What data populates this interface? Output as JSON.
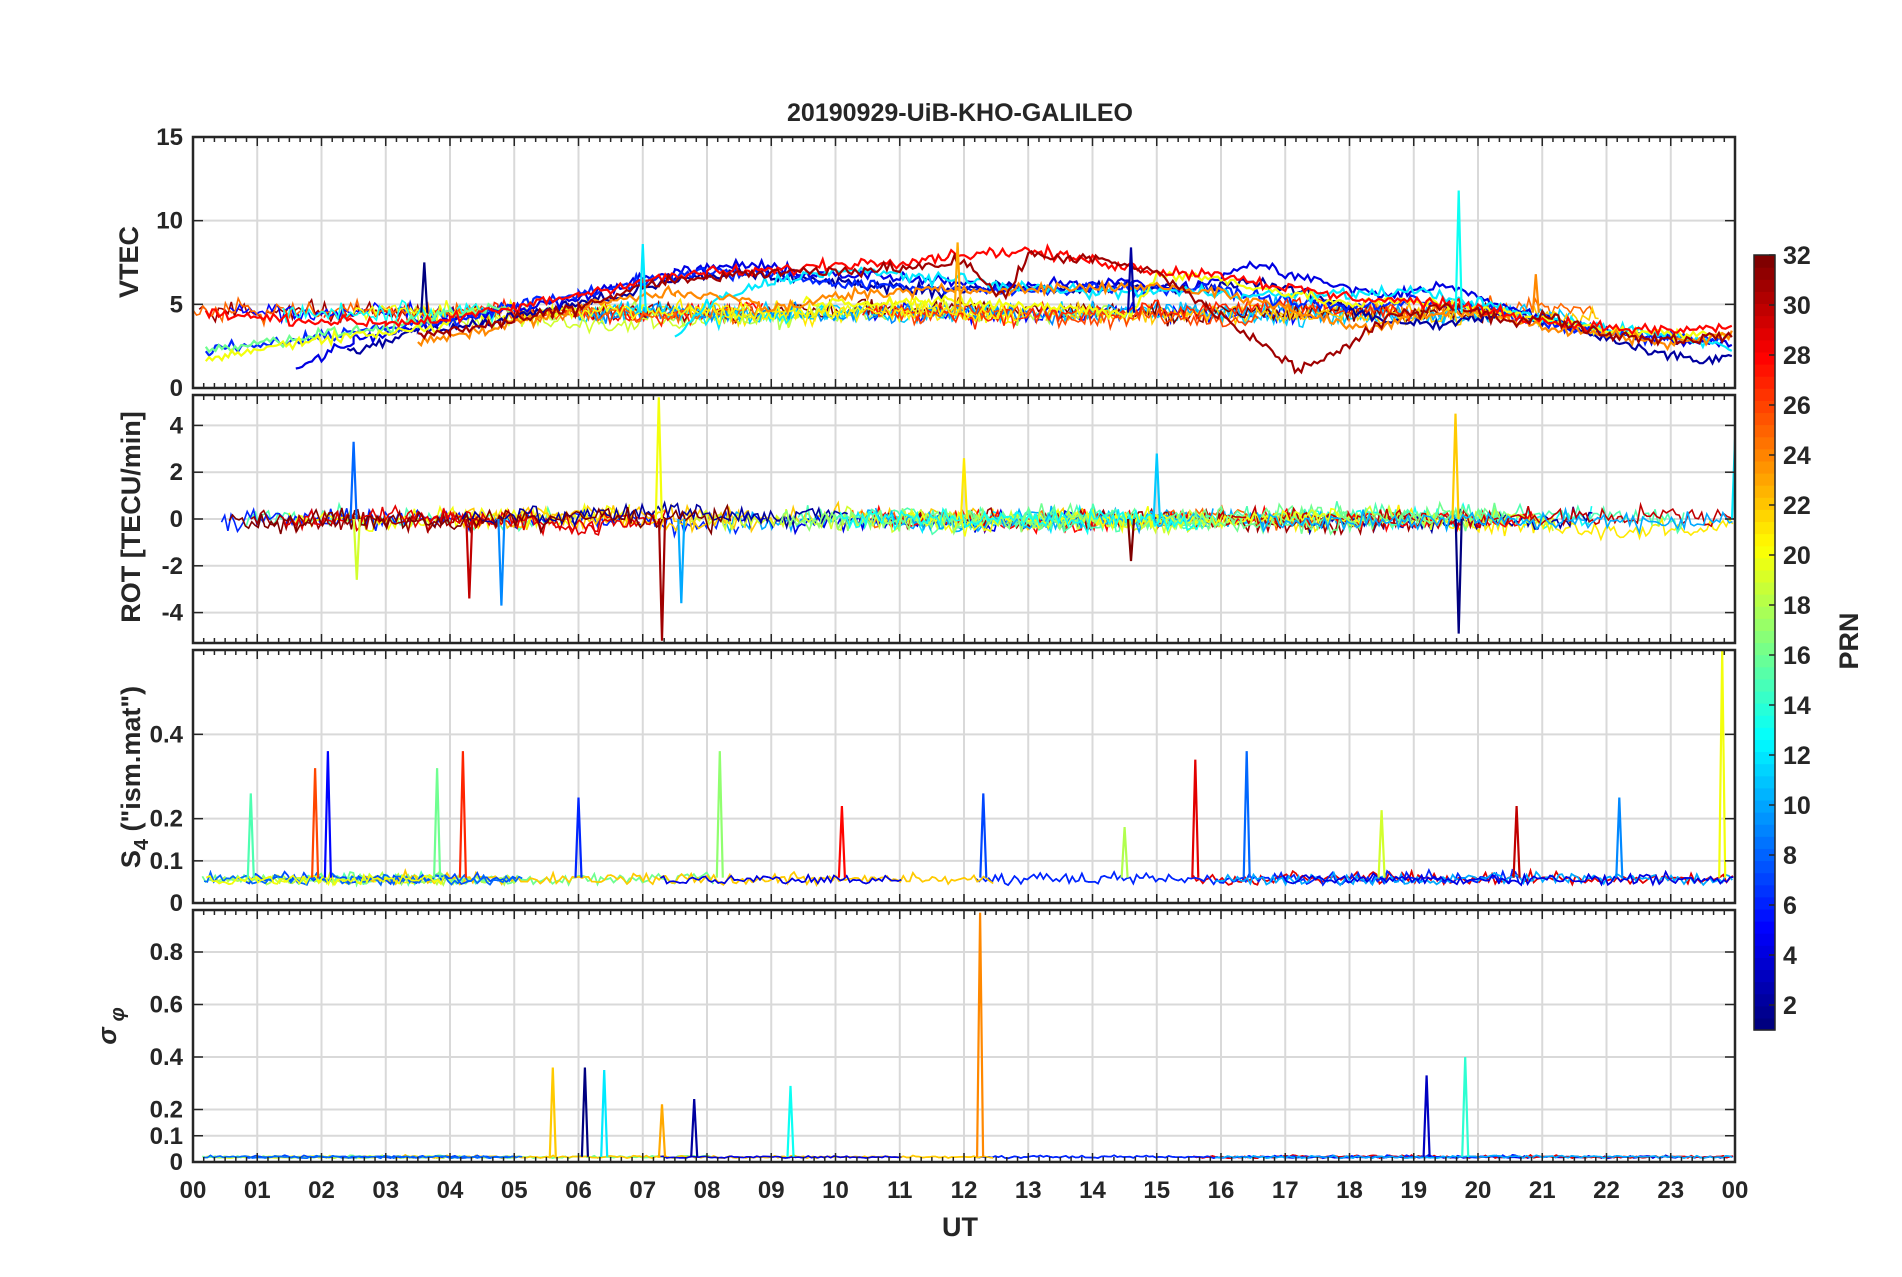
{
  "title": "20190929-UiB-KHO-GALILEO",
  "xlabel": "UT",
  "x_ticks": [
    "00",
    "01",
    "02",
    "03",
    "04",
    "05",
    "06",
    "07",
    "08",
    "09",
    "10",
    "11",
    "12",
    "13",
    "14",
    "15",
    "16",
    "17",
    "18",
    "19",
    "20",
    "21",
    "22",
    "23",
    "00"
  ],
  "chart_data": [
    {
      "type": "line",
      "ylabel": "VTEC",
      "ylim": [
        0,
        15
      ],
      "yticks": [
        0,
        5,
        10,
        15
      ],
      "grid": true,
      "baseline": 4.5,
      "noise": 0.4,
      "dense_series": 24,
      "events": [
        {
          "x": 3.6,
          "y": 7.5
        },
        {
          "x": 7.0,
          "y": 8.6
        },
        {
          "x": 11.9,
          "y": 8.7
        },
        {
          "x": 14.6,
          "y": 8.4
        },
        {
          "x": 19.7,
          "y": 11.8
        },
        {
          "x": 20.9,
          "y": 6.8
        }
      ],
      "series": [
        {
          "prn": 2,
          "x": [
            2.4,
            3.5,
            4.5,
            5.5,
            6.5,
            7.5,
            8.5,
            9.5,
            10.5,
            11.5,
            12.5,
            13.5,
            14.5,
            15.5,
            16.5,
            17.5,
            18.5,
            19.5,
            20.5,
            21.5,
            22.5,
            23.5,
            24.0
          ],
          "y": [
            2.0,
            3.5,
            3.8,
            4.7,
            5.4,
            6.4,
            6.9,
            6.5,
            6.2,
            5.8,
            6.1,
            5.8,
            6.1,
            5.9,
            6.4,
            5.4,
            4.1,
            3.8,
            4.5,
            3.6,
            2.3,
            1.6,
            2.2
          ]
        },
        {
          "prn": 4,
          "x": [
            1.6,
            2.5,
            3.5,
            4.5,
            5.5,
            6.5,
            7.5,
            8.5,
            9.5,
            10.5,
            11.5,
            12.5,
            13.5,
            14.5,
            15.5,
            16.5,
            17.5,
            18.5,
            19.5,
            20.5,
            21.5,
            22.5,
            23.5,
            24.0
          ],
          "y": [
            1.1,
            2.9,
            3.7,
            4.5,
            5.0,
            6.0,
            6.9,
            7.4,
            6.9,
            6.7,
            6.4,
            6.0,
            6.3,
            6.3,
            5.9,
            7.4,
            6.4,
            5.5,
            6.1,
            4.8,
            3.6,
            3.2,
            2.6,
            2.7
          ]
        },
        {
          "prn": 6,
          "x": [
            0.2,
            1.0,
            2.0,
            3.0,
            4.0,
            5.0,
            6.0,
            7.0,
            8.0,
            9.0,
            10.0,
            11.0,
            12.0,
            13.0,
            14.0,
            15.0,
            16.0,
            17.0,
            18.0,
            19.0,
            20.0,
            21.0,
            22.0,
            23.0,
            24.0
          ],
          "y": [
            2.3,
            2.6,
            3.1,
            3.6,
            4.0,
            4.9,
            5.6,
            6.4,
            6.9,
            6.8,
            6.3,
            6.1,
            5.8,
            5.8,
            6.0,
            5.9,
            5.9,
            5.2,
            4.8,
            5.2,
            4.9,
            3.8,
            3.3,
            3.0,
            2.9
          ]
        },
        {
          "prn": 12,
          "x": [
            7.5,
            8.0,
            9.0,
            10.0,
            11.0,
            12.0,
            13.0,
            14.0,
            15.0,
            16.0,
            17.0,
            18.0,
            19.0,
            20.0,
            21.0,
            22.0,
            23.0,
            24.0
          ],
          "y": [
            3.0,
            5.0,
            6.4,
            7.0,
            6.8,
            6.4,
            6.0,
            5.7,
            5.8,
            5.7,
            5.5,
            5.6,
            5.8,
            5.1,
            4.1,
            3.6,
            3.2,
            2.3
          ]
        },
        {
          "prn": 16,
          "x": [
            0.2,
            1.0,
            2.0,
            3.0,
            4.0,
            5.0
          ],
          "y": [
            2.3,
            2.7,
            3.2,
            3.6,
            4.4,
            4.8
          ]
        },
        {
          "prn": 20,
          "x": [
            0.2,
            1.0,
            2.0,
            3.0,
            4.0,
            9.5,
            10.0,
            11.0,
            12.0,
            13.0,
            14.0,
            14.6,
            15.0,
            16.0,
            17.0,
            18.0,
            19.0,
            20.0,
            21.0,
            22.0,
            23.0,
            24.0
          ],
          "y": [
            1.6,
            2.3,
            3.0,
            3.3,
            3.8,
            5.2,
            5.1,
            5.2,
            5.1,
            4.9,
            4.7,
            4.4,
            6.8,
            6.5,
            5.7,
            5.0,
            5.2,
            4.8,
            4.0,
            3.5,
            3.2,
            3.2
          ]
        },
        {
          "prn": 24,
          "x": [
            3.5,
            4.5,
            5.5,
            6.5,
            7.5,
            8.5,
            9.0,
            9.5,
            10.0,
            11.0,
            12.0,
            13.0,
            14.0,
            15.0,
            16.0,
            17.0,
            18.0,
            18.5,
            19.0,
            20.0,
            21.0,
            22.0,
            23.0,
            24.0
          ],
          "y": [
            2.9,
            3.4,
            4.3,
            5.2,
            5.8,
            5.3,
            4.7,
            4.9,
            5.6,
            5.7,
            5.9,
            5.9,
            6.0,
            6.1,
            5.7,
            4.8,
            3.7,
            3.6,
            4.4,
            4.6,
            3.6,
            3.2,
            2.7,
            3.2
          ]
        },
        {
          "prn": 28,
          "x": [
            0.2,
            1.0,
            2.0,
            3.0,
            4.0,
            5.0,
            6.0,
            7.0,
            8.0,
            9.0,
            10.0,
            11.0,
            12.0,
            13.0,
            14.0,
            15.0,
            16.0,
            17.0,
            18.0,
            19.0,
            20.0,
            21.0,
            22.0,
            23.0,
            24.0
          ],
          "y": [
            4.5,
            4.2,
            4.0,
            3.9,
            4.1,
            4.8,
            5.6,
            6.4,
            6.9,
            7.0,
            7.4,
            7.6,
            8.0,
            8.2,
            7.6,
            7.0,
            6.8,
            6.0,
            5.4,
            5.2,
            4.8,
            4.0,
            3.6,
            3.4,
            3.7
          ]
        },
        {
          "prn": 31,
          "x": [
            3.5,
            4.0,
            5.0,
            6.0,
            7.0,
            8.0,
            9.0,
            10.0,
            11.0,
            12.0,
            12.6,
            13.0,
            14.0,
            15.0,
            17.2,
            18.0,
            18.6,
            19.5,
            20.0,
            20.5,
            21.0,
            22.0,
            23.0,
            24.0
          ],
          "y": [
            3.1,
            3.4,
            4.0,
            4.8,
            6.1,
            6.6,
            6.9,
            6.9,
            7.2,
            7.6,
            5.3,
            7.9,
            7.7,
            6.9,
            1.1,
            2.5,
            4.2,
            5.0,
            4.6,
            3.8,
            4.4,
            3.2,
            2.9,
            3.1
          ]
        }
      ]
    },
    {
      "type": "line",
      "ylabel": "ROT [TECU/min]",
      "ylim": [
        -5.3,
        5.3
      ],
      "yticks": [
        -4,
        -2,
        0,
        2,
        4
      ],
      "grid": true,
      "baseline": 0,
      "noise": 0.3,
      "dense_series": 32,
      "events": [
        {
          "x": 2.5,
          "y": 3.3
        },
        {
          "x": 2.55,
          "y": -2.6
        },
        {
          "x": 4.3,
          "y": -3.4
        },
        {
          "x": 4.8,
          "y": -3.7
        },
        {
          "x": 7.25,
          "y": 5.2
        },
        {
          "x": 7.3,
          "y": -5.2
        },
        {
          "x": 7.6,
          "y": -3.6
        },
        {
          "x": 12.0,
          "y": 2.6
        },
        {
          "x": 14.6,
          "y": -1.8
        },
        {
          "x": 15.0,
          "y": 2.8
        },
        {
          "x": 19.65,
          "y": 4.5
        },
        {
          "x": 19.7,
          "y": -4.9
        },
        {
          "x": 24.0,
          "y": 3.4
        }
      ],
      "series": [
        {
          "prn": 3,
          "x": [
            0.2,
            24.0
          ],
          "y": [
            0,
            0
          ]
        },
        {
          "prn": 29,
          "x": [
            0.2,
            24.0
          ],
          "y": [
            0,
            0
          ]
        }
      ]
    },
    {
      "type": "line",
      "ylabel": "S4 (\"ism.mat\")",
      "ylabel_main": "S",
      "ylabel_sub": "4",
      "ylabel_rest": " (\"ism.mat\")",
      "ylim": [
        0,
        0.6
      ],
      "yticks": [
        0,
        0.1,
        0.2,
        0.4
      ],
      "grid": true,
      "baseline": 0.06,
      "noise": 0.015,
      "dense_series": 26,
      "events": [
        {
          "x": 0.9,
          "y": 0.26
        },
        {
          "x": 1.9,
          "y": 0.32
        },
        {
          "x": 2.1,
          "y": 0.36
        },
        {
          "x": 3.8,
          "y": 0.32
        },
        {
          "x": 4.2,
          "y": 0.36
        },
        {
          "x": 6.0,
          "y": 0.25
        },
        {
          "x": 8.2,
          "y": 0.36
        },
        {
          "x": 10.1,
          "y": 0.23
        },
        {
          "x": 12.3,
          "y": 0.26
        },
        {
          "x": 14.5,
          "y": 0.18
        },
        {
          "x": 15.6,
          "y": 0.34
        },
        {
          "x": 16.4,
          "y": 0.36
        },
        {
          "x": 18.5,
          "y": 0.22
        },
        {
          "x": 20.6,
          "y": 0.23
        },
        {
          "x": 22.2,
          "y": 0.25
        },
        {
          "x": 23.8,
          "y": 0.6
        }
      ],
      "series": [
        {
          "prn": 5,
          "x": [
            0.2,
            24.0
          ],
          "y": [
            0.05,
            0.05
          ]
        }
      ]
    },
    {
      "type": "line",
      "ylabel": "σφ",
      "ylabel_main": "σ",
      "ylabel_sub": "φ",
      "ylim": [
        0,
        0.96
      ],
      "yticks": [
        0,
        0.1,
        0.2,
        0.4,
        0.6,
        0.8
      ],
      "grid": true,
      "baseline": 0.02,
      "noise": 0.006,
      "dense_series": 22,
      "events": [
        {
          "x": 5.6,
          "y": 0.36
        },
        {
          "x": 6.1,
          "y": 0.36
        },
        {
          "x": 6.4,
          "y": 0.35
        },
        {
          "x": 7.3,
          "y": 0.22
        },
        {
          "x": 7.8,
          "y": 0.24
        },
        {
          "x": 9.3,
          "y": 0.29
        },
        {
          "x": 12.25,
          "y": 0.95
        },
        {
          "x": 19.2,
          "y": 0.33
        },
        {
          "x": 19.8,
          "y": 0.4
        }
      ],
      "series": [
        {
          "prn": 11,
          "x": [
            0.2,
            24.0
          ],
          "y": [
            0.02,
            0.02
          ]
        }
      ]
    }
  ],
  "colorbar": {
    "label": "PRN",
    "min": 1,
    "max": 32,
    "ticks": [
      2,
      4,
      6,
      8,
      10,
      12,
      14,
      16,
      18,
      20,
      22,
      24,
      26,
      28,
      30,
      32
    ],
    "colormap": "jet"
  }
}
